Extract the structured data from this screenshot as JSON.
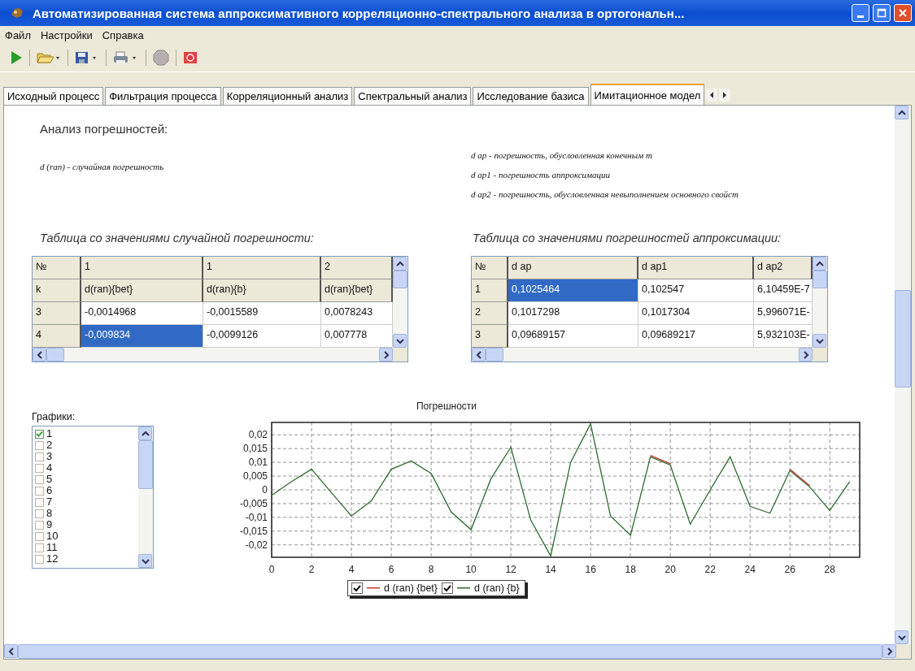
{
  "window": {
    "title": "Автоматизированная система аппроксимативного корреляционно-спектрального анализа в ортогональн..."
  },
  "menu": [
    {
      "label": "Файл"
    },
    {
      "label": "Настройки"
    },
    {
      "label": "Справка"
    }
  ],
  "tabs": [
    {
      "label": "Исходный процесс",
      "selected": false
    },
    {
      "label": "Фильтрация процесса",
      "selected": false
    },
    {
      "label": "Корреляционный анализ",
      "selected": false
    },
    {
      "label": "Спектральный анализ",
      "selected": false
    },
    {
      "label": "Исследование базиса",
      "selected": false
    },
    {
      "label": "Имитационное модел",
      "selected": true
    }
  ],
  "content": {
    "heading": "Анализ погрешностей:",
    "random_note": "d (ran) - случайная погрешность",
    "approx_notes": [
      "d ap - погрешность, обусловленная конечным m",
      "d ap1 - погрешность аппроксимации",
      "d ap2 - погрешность, обусловленная невыполнением основного свойст"
    ]
  },
  "random_table": {
    "caption": "Таблица со значениями случайной погрешности:",
    "header_rows": [
      [
        "№",
        "1",
        "1",
        "2"
      ],
      [
        "k",
        "d(ran){bet}",
        "d(ran){b}",
        "d(ran){bet}"
      ]
    ],
    "rows": [
      {
        "label": "3",
        "cells": [
          {
            "text": "-0,0014968",
            "selected": false
          },
          {
            "text": "-0,0015589",
            "selected": false
          },
          {
            "text": "0,0078243",
            "selected": false
          }
        ]
      },
      {
        "label": "4",
        "cells": [
          {
            "text": "-0,009834",
            "selected": true
          },
          {
            "text": "-0,0099126",
            "selected": false
          },
          {
            "text": "0,007778",
            "selected": false
          }
        ]
      }
    ]
  },
  "approx_table": {
    "caption": "Таблица со значениями погрешностей аппроксимации:",
    "header_rows": [
      [
        "№",
        "d ap",
        "d ap1",
        "d ap2"
      ]
    ],
    "rows": [
      {
        "label": "1",
        "cells": [
          {
            "text": "0,1025464",
            "selected": true
          },
          {
            "text": "0,102547",
            "selected": false
          },
          {
            "text": "6,10459E-7",
            "selected": false
          }
        ]
      },
      {
        "label": "2",
        "cells": [
          {
            "text": "0,1017298",
            "selected": false
          },
          {
            "text": "0,1017304",
            "selected": false
          },
          {
            "text": "5,996071E-",
            "selected": false
          }
        ]
      },
      {
        "label": "3",
        "cells": [
          {
            "text": "0,09689157",
            "selected": false
          },
          {
            "text": "0,09689217",
            "selected": false
          },
          {
            "text": "5,932103E-",
            "selected": false
          }
        ]
      }
    ]
  },
  "graphs": {
    "label": "Графики:",
    "items": [
      {
        "label": "1",
        "checked": true
      },
      {
        "label": "2",
        "checked": false
      },
      {
        "label": "3",
        "checked": false
      },
      {
        "label": "4",
        "checked": false
      },
      {
        "label": "5",
        "checked": false
      },
      {
        "label": "6",
        "checked": false
      },
      {
        "label": "7",
        "checked": false
      },
      {
        "label": "8",
        "checked": false
      },
      {
        "label": "9",
        "checked": false
      },
      {
        "label": "10",
        "checked": false
      },
      {
        "label": "11",
        "checked": false
      },
      {
        "label": "12",
        "checked": false
      }
    ]
  },
  "chart": {
    "legend_checkboxes": [
      {
        "checked": true
      },
      {
        "checked": true
      }
    ],
    "chart_data": {
      "type": "line",
      "title": "Погрешности",
      "x": [
        0,
        1,
        2,
        3,
        4,
        5,
        6,
        7,
        8,
        9,
        10,
        11,
        12,
        13,
        14,
        15,
        16,
        17,
        18,
        19,
        20,
        21,
        22,
        23,
        24,
        25,
        26,
        27,
        28,
        29
      ],
      "series": [
        {
          "name": "d (ran) {bet}",
          "color": "#c0392b",
          "values": [
            null,
            null,
            null,
            null,
            null,
            null,
            null,
            null,
            null,
            null,
            null,
            null,
            null,
            null,
            null,
            null,
            null,
            null,
            null,
            0.0125,
            0.0095,
            null,
            null,
            null,
            null,
            null,
            0.0075,
            0.0015,
            null,
            null
          ]
        },
        {
          "name": "d (ran) {b}",
          "color": "#2e6b2e",
          "values": [
            -0.002,
            0.003,
            0.0075,
            -0.001,
            -0.0095,
            -0.004,
            0.0075,
            0.0105,
            0.006,
            -0.008,
            -0.0145,
            0.004,
            0.0155,
            -0.011,
            -0.024,
            0.01,
            0.024,
            -0.0095,
            -0.0165,
            0.012,
            0.009,
            -0.0125,
            0.0,
            0.012,
            -0.006,
            -0.0085,
            0.007,
            0.001,
            -0.0075,
            0.003
          ]
        }
      ],
      "xlim": [
        0,
        29.5
      ],
      "ylim": [
        -0.0245,
        0.0245
      ],
      "grid": true,
      "legend": "bottom",
      "xticks": [
        0,
        2,
        4,
        6,
        8,
        10,
        12,
        14,
        16,
        18,
        20,
        22,
        24,
        26,
        28
      ],
      "yticks": [
        {
          "value": -0.02,
          "label": "-0,02"
        },
        {
          "value": -0.015,
          "label": "-0,015"
        },
        {
          "value": -0.01,
          "label": "-0,01"
        },
        {
          "value": -0.005,
          "label": "-0,005"
        },
        {
          "value": 0,
          "label": "0"
        },
        {
          "value": 0.005,
          "label": "0,005"
        },
        {
          "value": 0.01,
          "label": "0,01"
        },
        {
          "value": 0.015,
          "label": "0,015"
        },
        {
          "value": 0.02,
          "label": "0,02"
        }
      ]
    }
  }
}
